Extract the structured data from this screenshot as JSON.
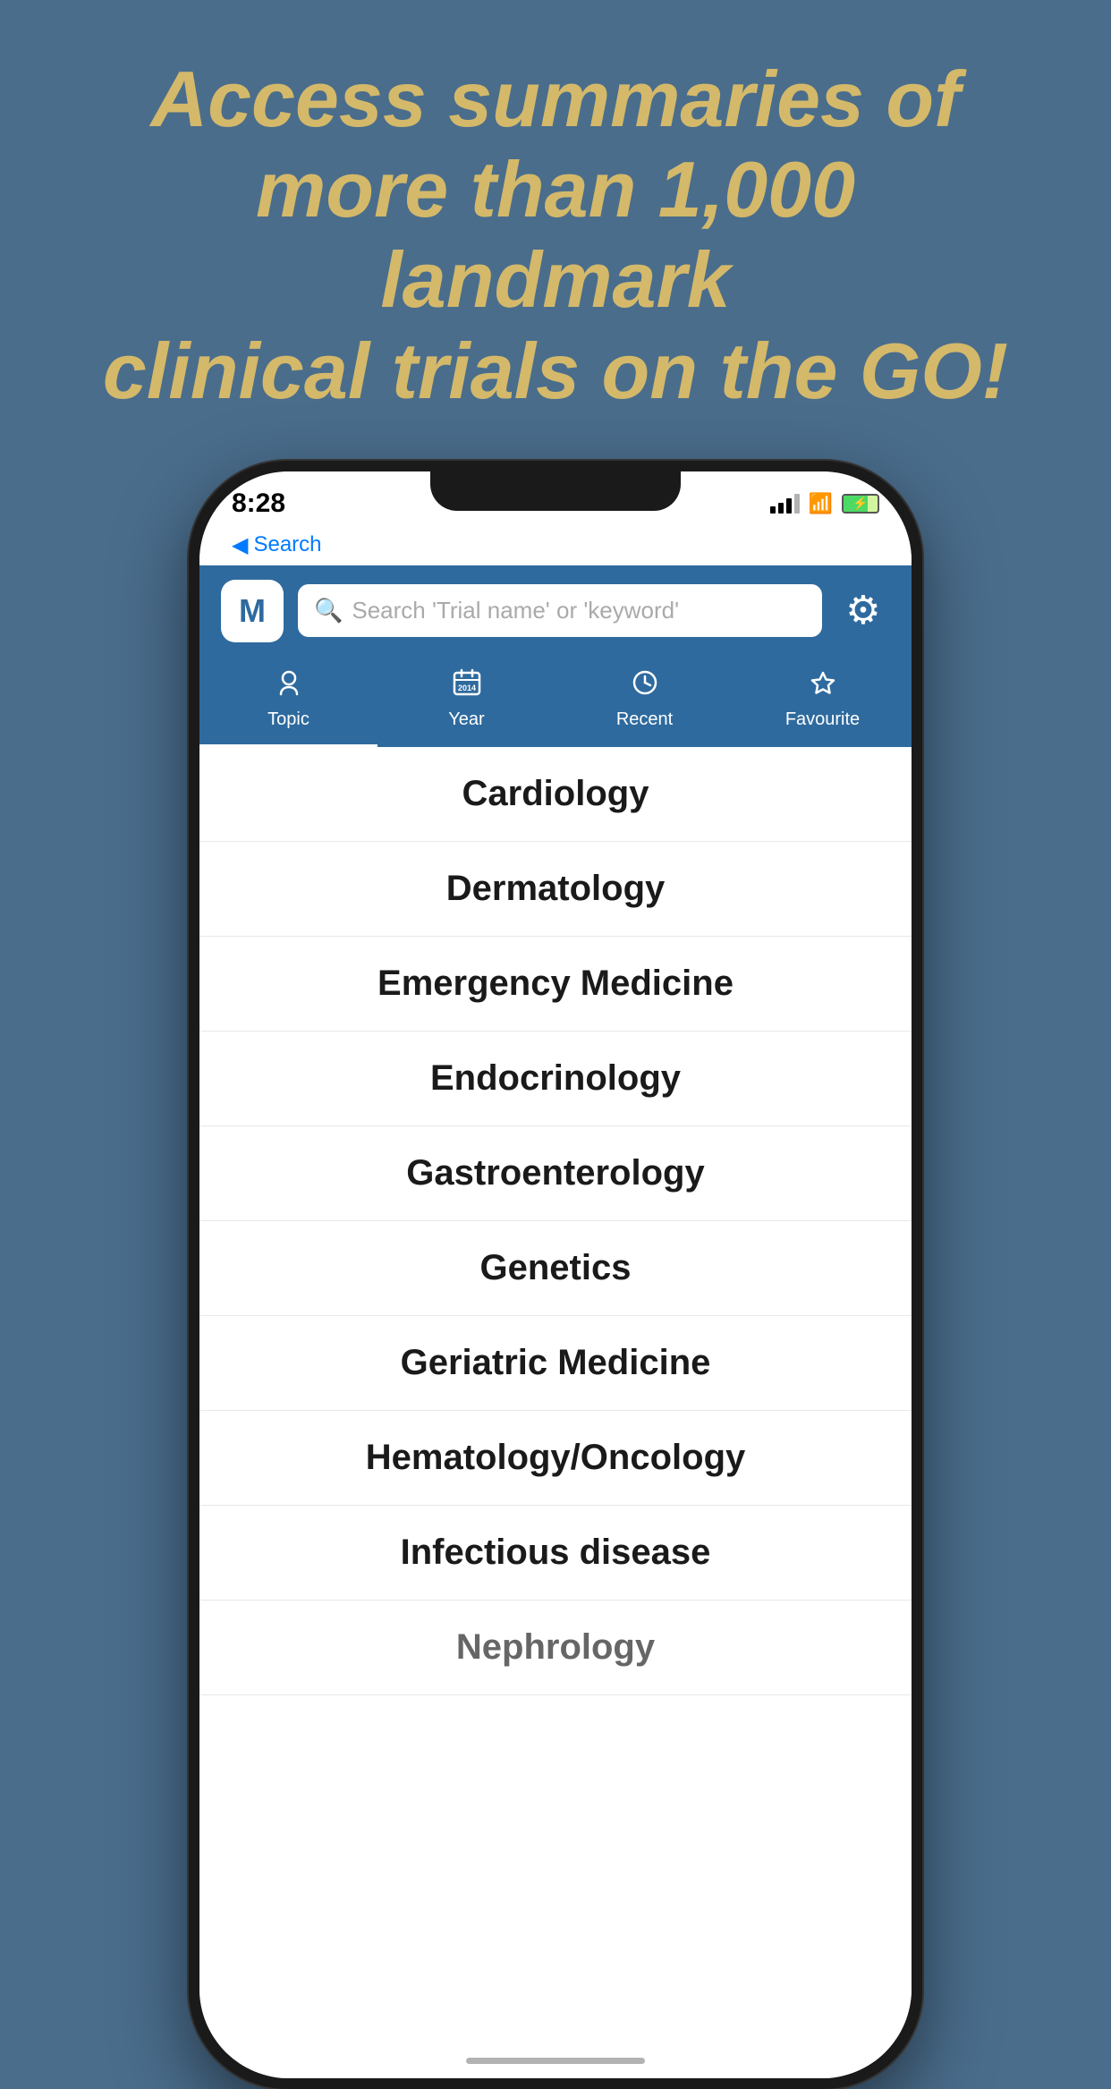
{
  "headline": {
    "line1": "Access summaries of",
    "line2": "more than 1,000 landmark",
    "line3": "clinical trials on the GO!"
  },
  "status": {
    "time": "8:28",
    "back_label": "Search"
  },
  "header": {
    "logo": "M",
    "search_placeholder": "Search 'Trial name' or 'keyword'",
    "settings_label": "Settings"
  },
  "tabs": [
    {
      "id": "topic",
      "label": "Topic",
      "icon": "♡",
      "active": true
    },
    {
      "id": "year",
      "label": "Year",
      "icon": "📅",
      "active": false
    },
    {
      "id": "recent",
      "label": "Recent",
      "icon": "🕐",
      "active": false
    },
    {
      "id": "favourite",
      "label": "Favourite",
      "icon": "☆",
      "active": false
    }
  ],
  "topics": [
    {
      "name": "Cardiology"
    },
    {
      "name": "Dermatology"
    },
    {
      "name": "Emergency Medicine"
    },
    {
      "name": "Endocrinology"
    },
    {
      "name": "Gastroenterology"
    },
    {
      "name": "Genetics"
    },
    {
      "name": "Geriatric Medicine"
    },
    {
      "name": "Hematology/Oncology"
    },
    {
      "name": "Infectious disease"
    },
    {
      "name": "Nephrology"
    }
  ],
  "colors": {
    "background": "#4a6d8c",
    "headline": "#d4b96a",
    "app_bar": "#2e6a9e"
  }
}
